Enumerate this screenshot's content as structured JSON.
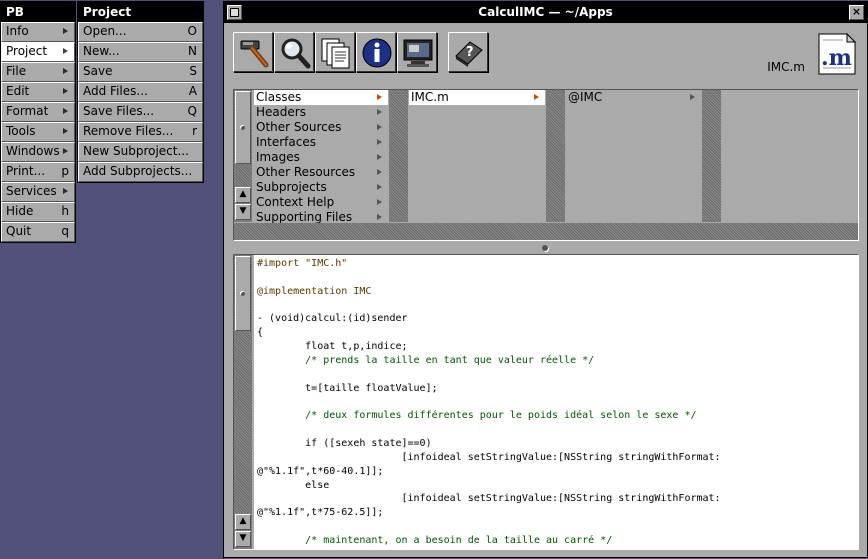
{
  "pb_menu": {
    "title": "PB",
    "items": [
      {
        "label": "Info",
        "key": "",
        "submenu": true,
        "active": false
      },
      {
        "label": "Project",
        "key": "",
        "submenu": true,
        "active": true
      },
      {
        "label": "File",
        "key": "",
        "submenu": true,
        "active": false
      },
      {
        "label": "Edit",
        "key": "",
        "submenu": true,
        "active": false
      },
      {
        "label": "Format",
        "key": "",
        "submenu": true,
        "active": false
      },
      {
        "label": "Tools",
        "key": "",
        "submenu": true,
        "active": false
      },
      {
        "label": "Windows",
        "key": "",
        "submenu": true,
        "active": false
      },
      {
        "label": "Print...",
        "key": "p",
        "submenu": false,
        "active": false
      },
      {
        "label": "Services",
        "key": "",
        "submenu": true,
        "active": false
      },
      {
        "label": "Hide",
        "key": "h",
        "submenu": false,
        "active": false
      },
      {
        "label": "Quit",
        "key": "q",
        "submenu": false,
        "active": false
      }
    ]
  },
  "project_menu": {
    "title": "Project",
    "items": [
      {
        "label": "Open...",
        "key": "O"
      },
      {
        "label": "New...",
        "key": "N"
      },
      {
        "label": "Save",
        "key": "S"
      },
      {
        "label": "Add Files...",
        "key": "A"
      },
      {
        "label": "Save Files...",
        "key": "Q"
      },
      {
        "label": "Remove Files...",
        "key": "r"
      },
      {
        "label": "New Subproject...",
        "key": ""
      },
      {
        "label": "Add Subprojects...",
        "key": ""
      }
    ]
  },
  "window": {
    "title": "CalculIMC — ~/Apps",
    "close_glyph": "×",
    "file_name": "IMC.m",
    "file_icon_text": ".m",
    "toolbar": [
      {
        "name": "build-icon"
      },
      {
        "name": "find-icon"
      },
      {
        "name": "loaded-files-icon"
      },
      {
        "name": "inspector-icon"
      },
      {
        "name": "launch-icon"
      },
      {
        "name": "help-icon"
      }
    ]
  },
  "browser": {
    "col1": [
      {
        "label": "Classes",
        "selected": true
      },
      {
        "label": "Headers",
        "selected": false
      },
      {
        "label": "Other Sources",
        "selected": false
      },
      {
        "label": "Interfaces",
        "selected": false
      },
      {
        "label": "Images",
        "selected": false
      },
      {
        "label": "Other Resources",
        "selected": false
      },
      {
        "label": "Subprojects",
        "selected": false
      },
      {
        "label": "Context Help",
        "selected": false
      },
      {
        "label": "Supporting Files",
        "selected": false
      }
    ],
    "col2": [
      {
        "label": "IMC.m",
        "selected": true
      }
    ],
    "col3": [
      {
        "label": "@IMC",
        "selected": false
      }
    ],
    "scroll_up": "▲",
    "scroll_down": "▼"
  },
  "editor": {
    "lines": [
      {
        "text": "#import \"IMC.h\"",
        "kind": "directive"
      },
      {
        "text": "",
        "kind": ""
      },
      {
        "text": "@implementation IMC",
        "kind": "directive"
      },
      {
        "text": "",
        "kind": ""
      },
      {
        "text": "- (void)calcul:(id)sender",
        "kind": ""
      },
      {
        "text": "{",
        "kind": ""
      },
      {
        "text": "        float t,p,indice;",
        "kind": ""
      },
      {
        "text": "        /* prends la taille en tant que valeur réelle */",
        "kind": "comment"
      },
      {
        "text": "",
        "kind": ""
      },
      {
        "text": "        t=[taille floatValue];",
        "kind": ""
      },
      {
        "text": "",
        "kind": ""
      },
      {
        "text": "        /* deux formules différentes pour le poids idéal selon le sexe */",
        "kind": "comment"
      },
      {
        "text": "",
        "kind": ""
      },
      {
        "text": "        if ([sexeh state]==0)",
        "kind": ""
      },
      {
        "text": "                        [infoideal setStringValue:[NSString stringWithFormat:",
        "kind": ""
      },
      {
        "text": "@\"%1.1f\",t*60-40.1]];",
        "kind": ""
      },
      {
        "text": "        else",
        "kind": ""
      },
      {
        "text": "                        [infoideal setStringValue:[NSString stringWithFormat:",
        "kind": ""
      },
      {
        "text": "@\"%1.1f\",t*75-62.5]];",
        "kind": ""
      },
      {
        "text": "",
        "kind": ""
      },
      {
        "text": "        /* maintenant, on a besoin de la taille au carré */",
        "kind": "comment"
      }
    ]
  }
}
